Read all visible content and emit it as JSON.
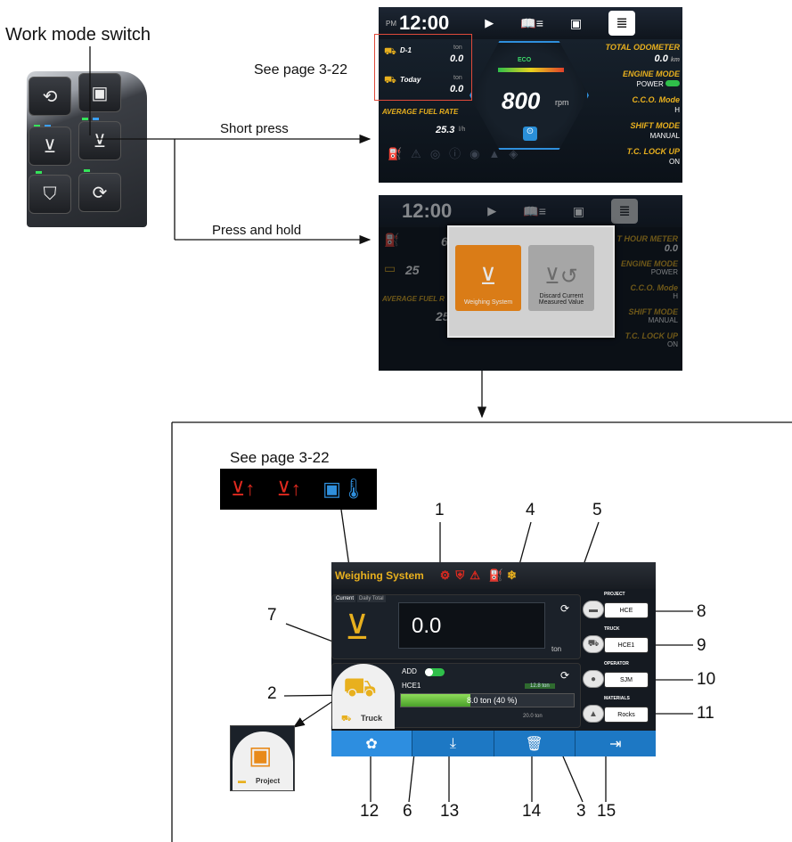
{
  "labels": {
    "work_mode_switch": "Work mode switch",
    "see_page_top": "See page 3-22",
    "see_page_bottom": "See page 3-22",
    "short_press": "Short press",
    "press_and_hold": "Press and hold"
  },
  "dashboard": {
    "ampm": "PM",
    "time": "12:00",
    "d1_label": "D-1",
    "d1_unit": "ton",
    "d1_value": "0.0",
    "today_label": "Today",
    "today_unit": "ton",
    "today_value": "0.0",
    "eco": "ECO",
    "rpm_value": "800",
    "rpm_unit": "rpm",
    "avg_fuel_label": "AVERAGE FUEL RATE",
    "avg_fuel_value": "25.3",
    "avg_fuel_unit": "l/h",
    "odometer_label": "TOTAL ODOMETER",
    "odometer_value": "0.0",
    "odometer_unit": "km",
    "engine_mode_label": "ENGINE MODE",
    "engine_mode_value": "POWER",
    "cco_label": "C.C.O. Mode",
    "cco_value": "H",
    "shift_label": "SHIFT MODE",
    "shift_value": "MANUAL",
    "tc_label": "T.C. LOCK UP",
    "tc_value": "ON"
  },
  "hold_screen": {
    "time": "12:00",
    "hour_meter": "T HOUR METER",
    "hour_value": "0.0",
    "engine_mode_label": "ENGINE MODE",
    "engine_mode_value": "POWER",
    "cco_label": "C.C.O. Mode",
    "cco_value": "H",
    "shift_label": "SHIFT MODE",
    "shift_value": "MANUAL",
    "tc_label": "T.C. LOCK UP",
    "tc_value": "ON",
    "avg_fuel": "AVERAGE FUEL R",
    "left_val_1": "6",
    "left_val_2": "25",
    "left_val_3": "25",
    "btn_weighing": "Weighing System",
    "btn_discard": "Discard Current Measured Value"
  },
  "weighing": {
    "title": "Weighing System",
    "tab_current": "Current",
    "tab_daily": "Daily Total",
    "value": "0.0",
    "unit": "ton",
    "add_label": "ADD",
    "truck_id": "HCE1",
    "progress_text": "8.0 ton (40 %)",
    "progress_fraction": 0.4,
    "target_text": "12.8 ton",
    "max_text": "20.0 ton",
    "mode_truck": "Truck",
    "mode_project": "Project",
    "project_label": "PROJECT",
    "project_value": "HCE",
    "truck_label": "TRUCK",
    "truck_value": "HCE1",
    "operator_label": "OPERATOR",
    "operator_value": "SJM",
    "materials_label": "MATERIALS",
    "materials_value": "Rocks"
  },
  "callouts": [
    "1",
    "2",
    "3",
    "4",
    "5",
    "6",
    "7",
    "8",
    "9",
    "10",
    "11",
    "12",
    "13",
    "14",
    "15"
  ],
  "colors": {
    "accent_blue": "#1d78c4",
    "warning_yellow": "#e8b01e",
    "warning_red": "#e02a1f",
    "popup_orange": "#f28a1a"
  }
}
